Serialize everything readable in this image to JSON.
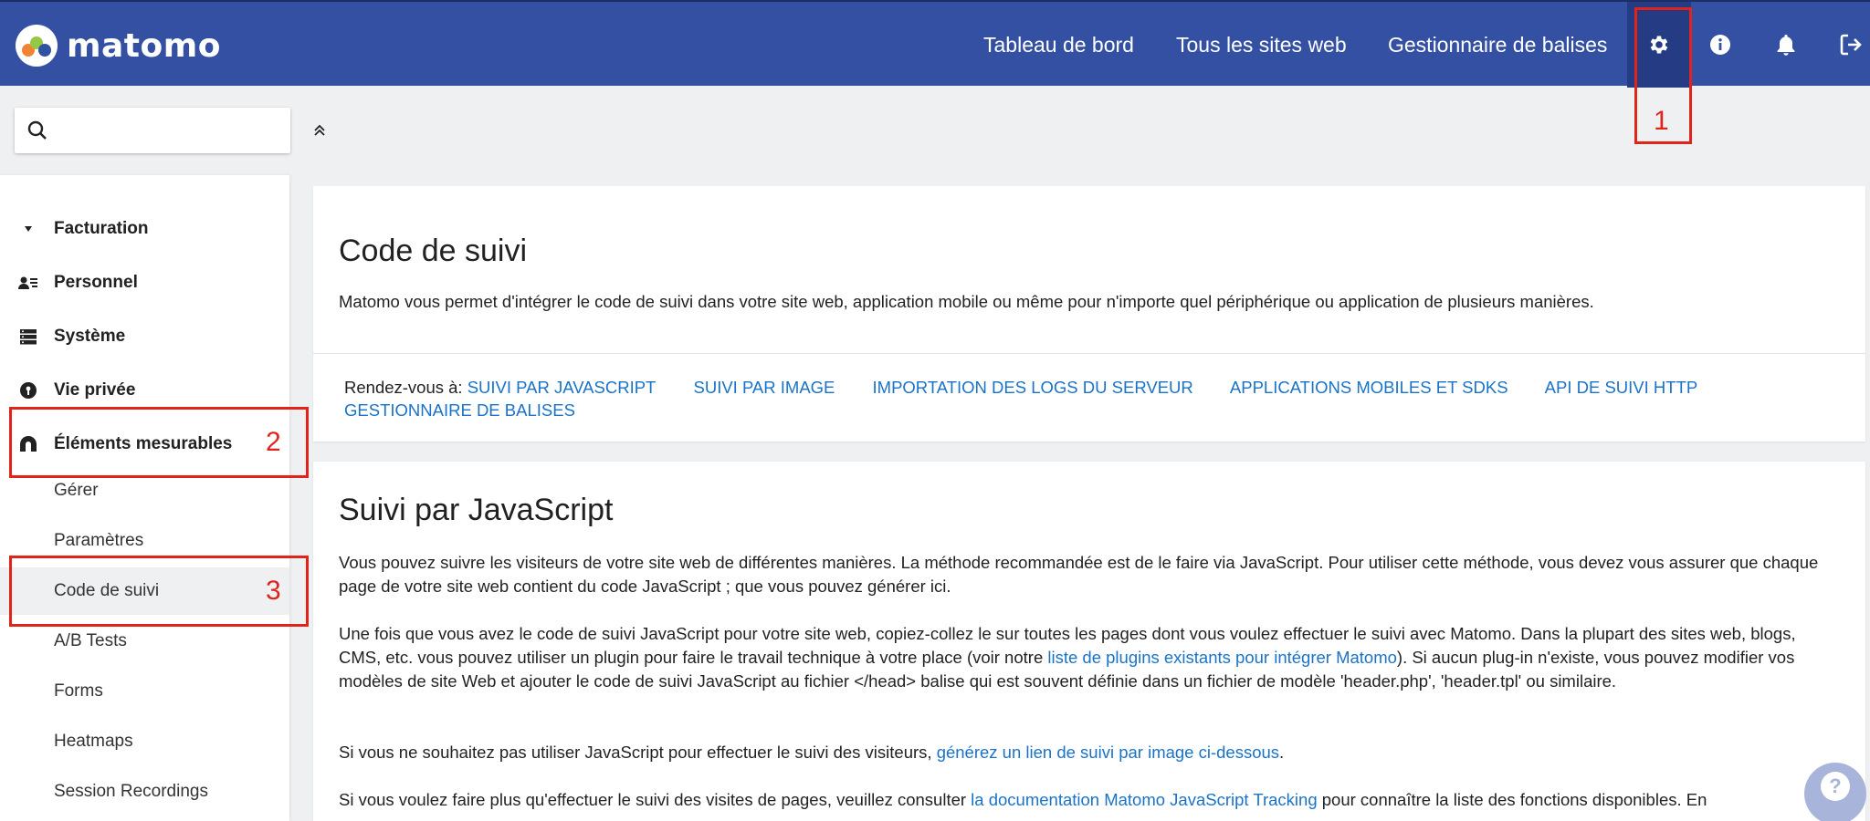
{
  "brand": {
    "name": "matomo"
  },
  "topnav": {
    "items": [
      {
        "label": "Tableau de bord"
      },
      {
        "label": "Tous les sites web"
      },
      {
        "label": "Gestionnaire de balises"
      }
    ],
    "icons": [
      "gear-icon",
      "info-icon",
      "bell-icon",
      "logout-icon"
    ]
  },
  "search": {
    "placeholder": "",
    "value": ""
  },
  "sidebar": {
    "sections": [
      {
        "label": "Facturation",
        "icon": "caret-down-icon"
      },
      {
        "label": "Personnel",
        "icon": "person-icon"
      },
      {
        "label": "Système",
        "icon": "server-icon"
      },
      {
        "label": "Vie privée",
        "icon": "privacy-icon"
      },
      {
        "label": "Éléments mesurables",
        "icon": "measurables-icon"
      }
    ],
    "subitems": [
      {
        "label": "Gérer"
      },
      {
        "label": "Paramètres"
      },
      {
        "label": "Code de suivi",
        "active": true
      },
      {
        "label": "A/B Tests"
      },
      {
        "label": "Forms"
      },
      {
        "label": "Heatmaps"
      },
      {
        "label": "Session Recordings"
      }
    ]
  },
  "tracking_card": {
    "title": "Code de suivi",
    "intro": "Matomo vous permet d'intégrer le code de suivi dans votre site web, application mobile ou même pour n'importe quel périphérique ou application de plusieurs manières.",
    "goto_label": "Rendez-vous à:",
    "goto_links": [
      "SUIVI PAR JAVASCRIPT",
      "SUIVI PAR IMAGE",
      "IMPORTATION DES LOGS DU SERVEUR",
      "APPLICATIONS MOBILES ET SDKS",
      "API DE SUIVI HTTP",
      "GESTIONNAIRE DE BALISES"
    ]
  },
  "js_card": {
    "title": "Suivi par JavaScript",
    "p1": "Vous pouvez suivre les visiteurs de votre site web de différentes manières. La méthode recommandée est de le faire via JavaScript. Pour utiliser cette méthode, vous devez vous assurer que chaque page de votre site web contient du code JavaScript ; que vous pouvez générer ici.",
    "p2_before": "Une fois que vous avez le code de suivi JavaScript pour votre site web, copiez-collez le sur toutes les pages dont vous voulez effectuer le suivi avec Matomo. Dans la plupart des sites web, blogs, CMS, etc. vous pouvez utiliser un plugin pour faire le travail technique à votre place (voir notre ",
    "p2_link": "liste de plugins existants pour intégrer Matomo",
    "p2_after": "). Si aucun plug-in n'existe, vous pouvez modifier vos modèles de site Web et ajouter le code de suivi JavaScript au fichier </head> balise qui est souvent définie dans un fichier de modèle 'header.php', 'header.tpl' ou similaire.",
    "p3_before": "Si vous ne souhaitez pas utiliser JavaScript pour effectuer le suivi des visiteurs, ",
    "p3_link": "générez un lien de suivi par image ci-dessous",
    "p3_after": ".",
    "p4_before": "Si vous voulez faire plus qu'effectuer le suivi des visites de pages, veuillez consulter ",
    "p4_link": "la documentation Matomo JavaScript Tracking",
    "p4_after": " pour connaître la liste des fonctions disponibles. En"
  },
  "annotations": [
    "1",
    "2",
    "3"
  ],
  "help": {
    "label": "?"
  },
  "colors": {
    "header": "#3450a3",
    "header_active": "#253c85",
    "link": "#1a73c8",
    "annotation": "#e0241b"
  }
}
